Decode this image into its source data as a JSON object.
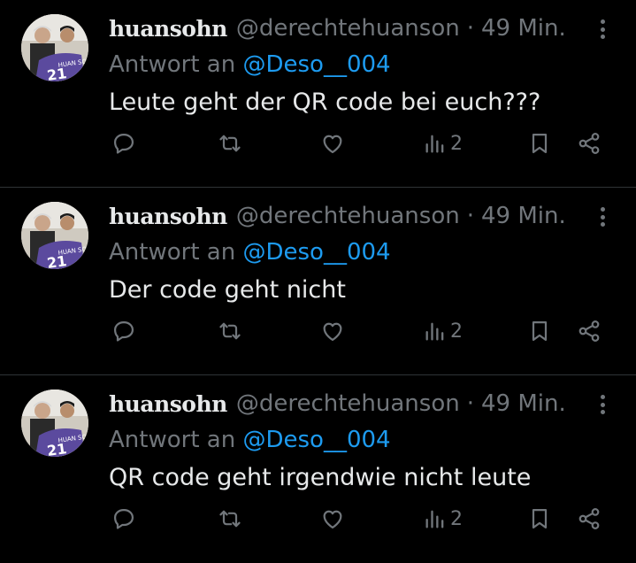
{
  "tweets": [
    {
      "display_name": "huansohn",
      "handle": "@derechtehuanson",
      "separator": "·",
      "time": "49 Min.",
      "reply_prefix": "Antwort an",
      "reply_mention": "@Deso__004",
      "text": "Leute geht der QR code bei euch???",
      "views": "2",
      "avatar_jersey_text": "HUAN SON",
      "avatar_jersey_number": "21"
    },
    {
      "display_name": "huansohn",
      "handle": "@derechtehuanson",
      "separator": "·",
      "time": "49 Min.",
      "reply_prefix": "Antwort an",
      "reply_mention": "@Deso__004",
      "text": "Der code geht nicht",
      "views": "2",
      "avatar_jersey_text": "HUAN SON",
      "avatar_jersey_number": "21"
    },
    {
      "display_name": "huansohn",
      "handle": "@derechtehuanson",
      "separator": "·",
      "time": "49 Min.",
      "reply_prefix": "Antwort an",
      "reply_mention": "@Deso__004",
      "text": "QR code geht irgendwie nicht leute",
      "views": "2",
      "avatar_jersey_text": "HUAN SON",
      "avatar_jersey_number": "21"
    }
  ],
  "icons": [
    "more-icon",
    "reply-icon",
    "retweet-icon",
    "like-icon",
    "views-icon",
    "bookmark-icon",
    "share-icon"
  ],
  "colors": {
    "background": "#000000",
    "text": "#e7e9ea",
    "muted": "#71767b",
    "accent": "#1d9bf0",
    "divider": "#2f3336"
  }
}
